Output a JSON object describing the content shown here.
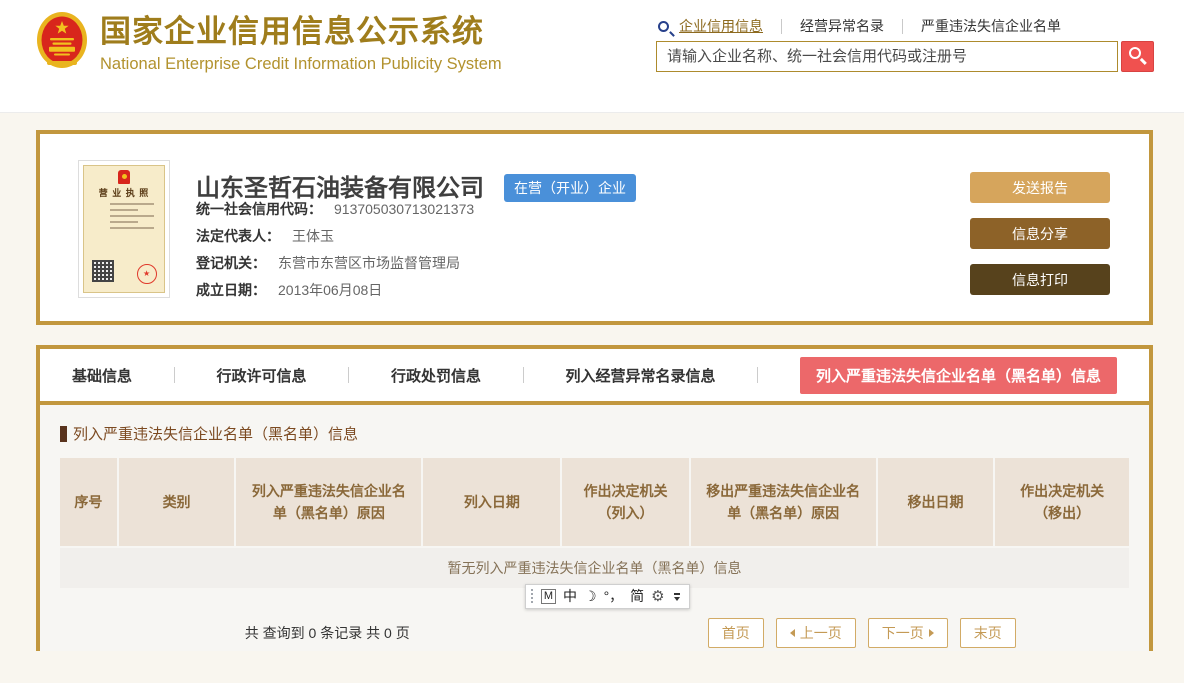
{
  "header": {
    "site_title_zh": "国家企业信用信息公示系统",
    "site_title_en": "National Enterprise Credit Information Publicity System",
    "nav_links": [
      "企业信用信息",
      "经营异常名录",
      "严重违法失信企业名单"
    ],
    "search_placeholder": "请输入企业名称、统一社会信用代码或注册号"
  },
  "company": {
    "name": "山东圣哲石油装备有限公司",
    "status_badge": "在营（开业）企业",
    "license_caption": "营 业 执 照",
    "fields": [
      {
        "label": "统一社会信用代码：",
        "value": "913705030713021373"
      },
      {
        "label": "法定代表人：",
        "value": "王体玉"
      },
      {
        "label": "登记机关：",
        "value": "东营市东营区市场监督管理局"
      },
      {
        "label": "成立日期：",
        "value": "2013年06月08日"
      }
    ],
    "actions": [
      "发送报告",
      "信息分享",
      "信息打印"
    ]
  },
  "tabs": [
    "基础信息",
    "行政许可信息",
    "行政处罚信息",
    "列入经营异常名录信息",
    "列入严重违法失信企业名单（黑名单）信息"
  ],
  "section": {
    "title": "列入严重违法失信企业名单（黑名单）信息",
    "table_headers": [
      "序号",
      "类别",
      "列入严重违法失信企业名单（黑名单）原因",
      "列入日期",
      "作出决定机关（列入）",
      "移出严重违法失信企业名单（黑名单）原因",
      "移出日期",
      "作出决定机关（移出）"
    ],
    "empty_text": "暂无列入严重违法失信企业名单（黑名单）信息",
    "summary": "共 查询到 0 条记录 共 0 页",
    "pagination": [
      "首页",
      "上一页",
      "下一页",
      "末页"
    ]
  },
  "ime_bar": {
    "items": [
      "M",
      "中",
      "☽",
      "°，",
      "简",
      "⚙"
    ]
  },
  "colors": {
    "gold_border": "#c2973e",
    "brand_gold": "#9f7d1c",
    "badge_blue": "#4a90d9",
    "tab_active_red": "#ec686a",
    "search_button_red": "#f0514f",
    "button_send": "#d6a55c",
    "button_share": "#8d6228",
    "button_print": "#57421c",
    "table_header_bg": "#ece2d7"
  }
}
